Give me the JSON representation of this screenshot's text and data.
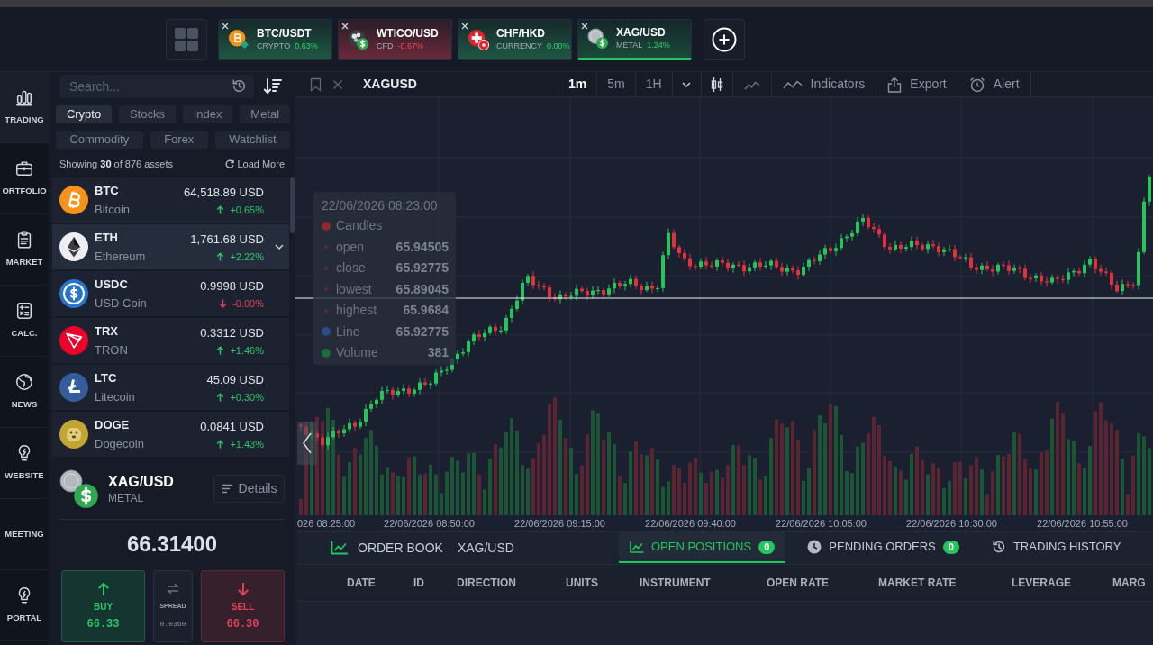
{
  "top_bar": {
    "tabs": [
      {
        "symbol": "BTC/USDT",
        "category": "CRYPTO",
        "change": "0.63%",
        "falling": false,
        "selected": false
      },
      {
        "symbol": "WTICO/USD",
        "category": "CFD",
        "change": "-0.67%",
        "falling": true,
        "selected": false
      },
      {
        "symbol": "CHF/HKD",
        "category": "CURRENCY",
        "change": "0.00%",
        "falling": false,
        "selected": false
      },
      {
        "symbol": "XAG/USD",
        "category": "METAL",
        "change": "1.24%",
        "falling": false,
        "selected": true
      }
    ]
  },
  "sidebar": {
    "items": [
      {
        "label": "TRADING",
        "selected": true
      },
      {
        "label": "ORTFOLIO",
        "selected": false
      },
      {
        "label": "MARKET",
        "selected": false
      },
      {
        "label": "CALC.",
        "selected": false
      },
      {
        "label": "NEWS",
        "selected": false
      },
      {
        "label": "WEBSITE",
        "selected": false
      },
      {
        "label": "MEETING",
        "selected": false
      },
      {
        "label": "PORTAL",
        "selected": false
      }
    ]
  },
  "asset_panel": {
    "search": {
      "placeholder": "Search..."
    },
    "filters": [
      {
        "label": "Crypto",
        "selected": true
      },
      {
        "label": "Stocks",
        "selected": false
      },
      {
        "label": "Index",
        "selected": false
      },
      {
        "label": "Metal",
        "selected": false
      },
      {
        "label": "Commodity",
        "selected": false
      },
      {
        "label": "Forex",
        "selected": false
      },
      {
        "label": "Watchlist",
        "selected": false
      }
    ],
    "summary": "Showing **30** of 876 assets",
    "load_more": "Load More",
    "assets": [
      {
        "symbol": "BTC",
        "name": "Bitcoin",
        "price": "64,518.89 USD",
        "change": "+0.65%",
        "falling": false,
        "selected": false
      },
      {
        "symbol": "ETH",
        "name": "Ethereum",
        "price": "1,761.68 USD",
        "change": "+2.22%",
        "falling": false,
        "selected": true
      },
      {
        "symbol": "USDC",
        "name": "USD Coin",
        "price": "0.9998 USD",
        "change": "-0.00%",
        "falling": true,
        "selected": false
      },
      {
        "symbol": "TRX",
        "name": "TRON",
        "price": "0.3312 USD",
        "change": "+1.46%",
        "falling": false,
        "selected": false
      },
      {
        "symbol": "LTC",
        "name": "Litecoin",
        "price": "45.09 USD",
        "change": "+0.30%",
        "falling": false,
        "selected": false
      },
      {
        "symbol": "DOGE",
        "name": "Dogecoin",
        "price": "0.0841 USD",
        "change": "+1.43%",
        "falling": false,
        "selected": false
      }
    ]
  },
  "quote": {
    "symbol": "XAG/USD",
    "category": "METAL",
    "details_button": "Details",
    "price": "66.31400",
    "buy": {
      "label": "BUY",
      "price": "66.33"
    },
    "spread": {
      "label": "SPREAD",
      "value": "0.0360"
    },
    "sell": {
      "label": "SELL",
      "price": "66.30"
    }
  },
  "chart": {
    "symbol": "XAGUSD",
    "intervals": [
      {
        "label": "1m",
        "selected": true
      },
      {
        "label": "5m",
        "selected": false
      },
      {
        "label": "1H",
        "selected": false
      }
    ],
    "tools": [
      "Indicators",
      "Export",
      "Alert"
    ],
    "tooltip": {
      "timestamp": "22/06/2026 08:23:00",
      "series": [
        {
          "name": "Candles",
          "color": "#8c2a2e",
          "fields": [
            {
              "label": "open",
              "value": "65.94505"
            },
            {
              "label": "close",
              "value": "65.92775"
            },
            {
              "label": "lowest",
              "value": "65.89045"
            },
            {
              "label": "highest",
              "value": "65.9684"
            }
          ]
        },
        {
          "name": "Line",
          "color": "#2f4a86",
          "value": "65.92775"
        },
        {
          "name": "Volume",
          "color": "#1f6b3a",
          "value": "381"
        }
      ]
    },
    "time_labels": [
      "026 08:25:00",
      "22/06/2026 08:50:00",
      "22/06/2026 09:15:00",
      "22/06/2026 09:40:00",
      "22/06/2026 10:05:00",
      "22/06/2026 10:30:00",
      "22/06/2026 10:55:00"
    ]
  },
  "bottom_panel": {
    "order_book": {
      "label": "ORDER BOOK",
      "instrument": "XAG/USD"
    },
    "tabs": [
      {
        "label": "OPEN POSITIONS",
        "count": "0",
        "selected": true
      },
      {
        "label": "PENDING ORDERS",
        "count": "0",
        "selected": false
      },
      {
        "label": "TRADING HISTORY",
        "selected": false
      }
    ],
    "columns": [
      "DATE",
      "ID",
      "DIRECTION",
      "UNITS",
      "INSTRUMENT",
      "OPEN RATE",
      "MARKET RATE",
      "LEVERAGE",
      "MARG"
    ]
  }
}
